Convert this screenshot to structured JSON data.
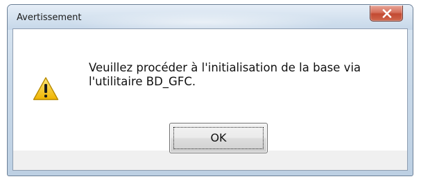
{
  "dialog": {
    "title": "Avertissement",
    "message_lines": [
      "Veuillez procéder à l'initialisation de la base via",
      "l'utilitaire BD_GFC."
    ],
    "icon": "warning-icon",
    "ok_label": "OK",
    "close_icon": "close-icon"
  },
  "colors": {
    "close_button": "#c24a32",
    "warning_fill": "#f5c400",
    "window_frame": "#c9d9e9"
  }
}
